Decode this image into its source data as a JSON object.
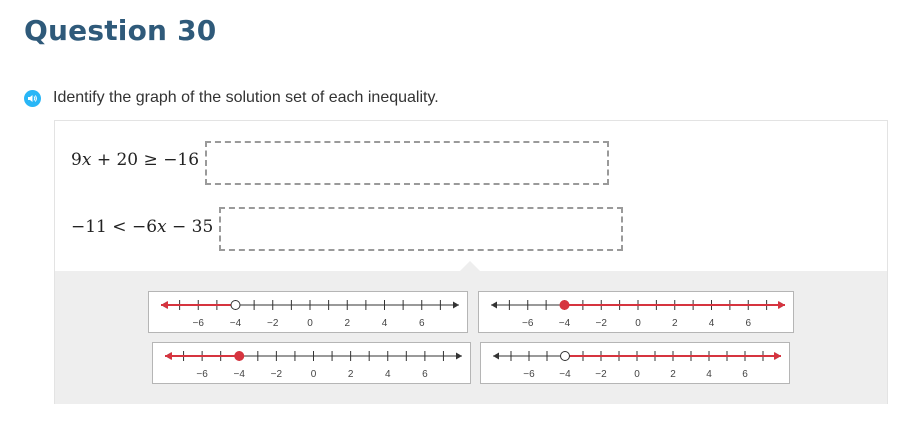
{
  "title": "Question 30",
  "prompt": "Identify the graph of the solution set of each inequality.",
  "audio_icon": "speaker-icon",
  "inequalities": [
    {
      "a": "9",
      "var": "x",
      "op1": "+",
      "b": "20",
      "rel": "≥",
      "c": "−16"
    },
    {
      "lhs": "−11",
      "rel": "<",
      "a": "−6",
      "var": "x",
      "op1": "−",
      "b": "35"
    }
  ],
  "number_line": {
    "min": -8,
    "max": 8,
    "labels": [
      -6,
      -4,
      -2,
      0,
      2,
      4,
      6
    ],
    "label_text": [
      "−6",
      "−4",
      "−2",
      "0",
      "2",
      "4",
      "6"
    ]
  },
  "answer_options": [
    {
      "id": "A",
      "point": -4,
      "closed": false,
      "direction": "left"
    },
    {
      "id": "B",
      "point": -4,
      "closed": true,
      "direction": "right"
    },
    {
      "id": "C",
      "point": -4,
      "closed": true,
      "direction": "left"
    },
    {
      "id": "D",
      "point": -4,
      "closed": false,
      "direction": "right"
    }
  ],
  "colors": {
    "title": "#2f5a7a",
    "accent_red": "#d6343f",
    "audio_blue": "#29b6f6",
    "tray_gray": "#eeeeee"
  }
}
